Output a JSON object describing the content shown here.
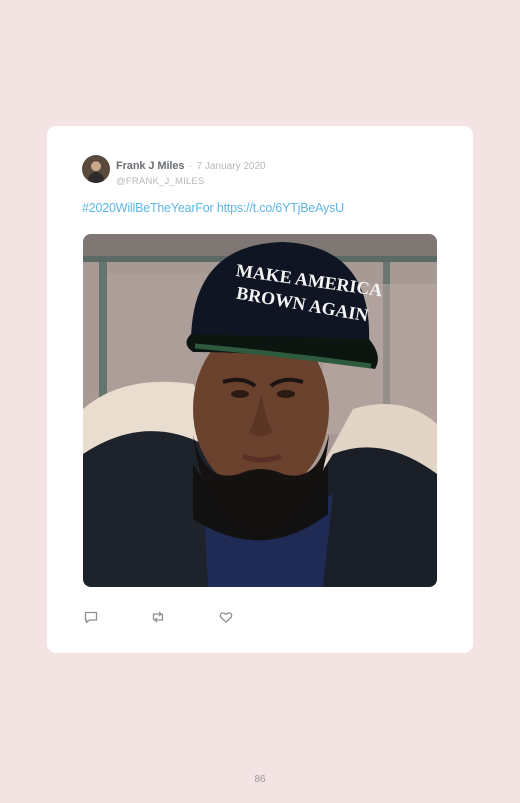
{
  "tweet": {
    "author_name": "Frank J Miles",
    "separator": "·",
    "date": "7 January 2020",
    "handle": "@FRANK_J_MILES",
    "hashtag": "#2020WillBeTheYearFor",
    "link": "https://t.co/6YTjBeAysU",
    "image": {
      "hat_line_1": "MAKE AMERICA",
      "hat_line_2": "BROWN AGAIN"
    },
    "actions": {
      "reply_icon": "reply-icon",
      "retweet_icon": "retweet-icon",
      "like_icon": "heart-icon"
    }
  },
  "page": {
    "number": "86"
  },
  "colors": {
    "background": "#f3e3e3",
    "card": "#ffffff",
    "link": "#5eb7e6",
    "muted": "#b5b8bb"
  }
}
